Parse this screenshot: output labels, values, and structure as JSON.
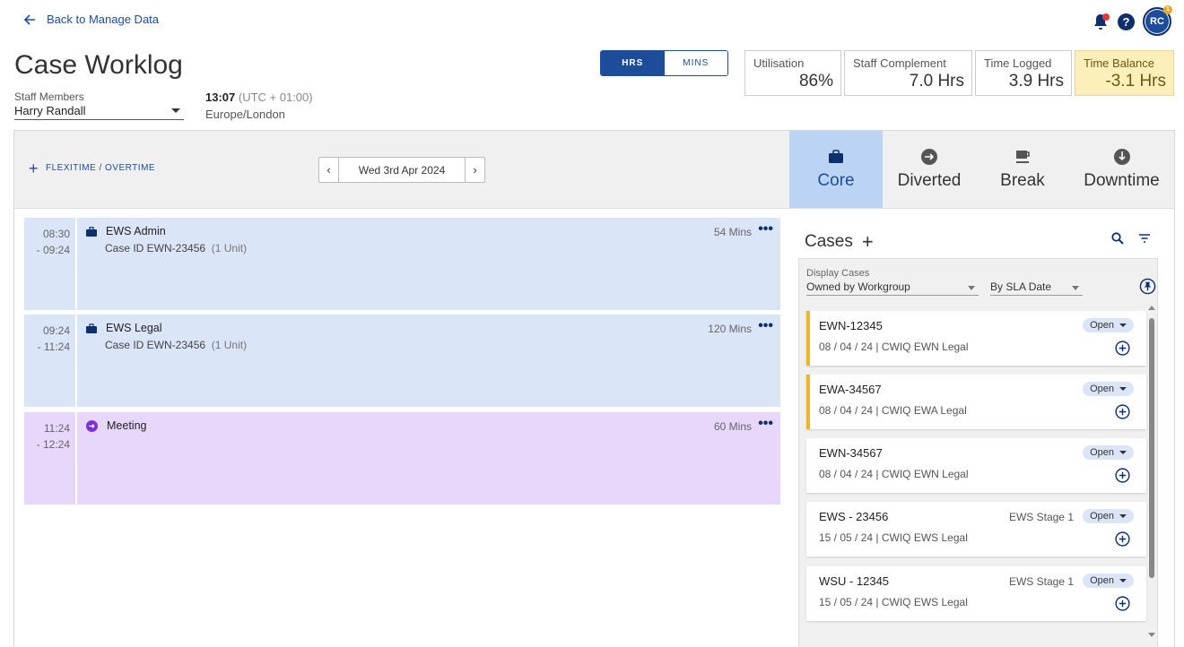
{
  "nav": {
    "back_label": "Back to Manage Data"
  },
  "user": {
    "initials": "RC",
    "notification_count": "1"
  },
  "page": {
    "title": "Case Worklog"
  },
  "staff": {
    "label": "Staff Members",
    "selected": "Harry Randall"
  },
  "clock": {
    "time": "13:07",
    "offset": "(UTC + 01:00)",
    "region": "Europe/London"
  },
  "unit_toggle": {
    "hrs": "HRS",
    "mins": "MINS",
    "selected": "HRS"
  },
  "stats": [
    {
      "label": "Utilisation",
      "value": "86%"
    },
    {
      "label": "Staff Complement",
      "value": "7.0 Hrs"
    },
    {
      "label": "Time Logged",
      "value": "3.9 Hrs"
    },
    {
      "label": "Time Balance",
      "value": "-3.1 Hrs"
    }
  ],
  "toolbar": {
    "flexi_label": "FLEXITIME / OVERTIME",
    "date": "Wed 3rd Apr 2024",
    "prev": "‹",
    "next": "›"
  },
  "modes": [
    {
      "label": "Core",
      "icon": "briefcase-icon"
    },
    {
      "label": "Diverted",
      "icon": "diverted-icon"
    },
    {
      "label": "Break",
      "icon": "coffee-icon"
    },
    {
      "label": "Downtime",
      "icon": "downtime-icon"
    }
  ],
  "entries": [
    {
      "start": "08:30",
      "end": "- 09:24",
      "name": "EWS Admin",
      "case": "Case ID EWN-23456",
      "units": "(1 Unit)",
      "duration": "54 Mins"
    },
    {
      "start": "09:24",
      "end": "- 11:24",
      "name": "EWS Legal",
      "case": "Case ID EWN-23456",
      "units": "(1 Unit)",
      "duration": "120 Mins"
    },
    {
      "start": "11:24",
      "end": "- 12:24",
      "name": "Meeting",
      "duration": "60 Mins"
    }
  ],
  "cases": {
    "title": "Cases",
    "add": "+",
    "display_label": "Display Cases",
    "display_value": "Owned by Workgroup",
    "sort_value": "By SLA Date",
    "items": [
      {
        "id": "EWN-12345",
        "meta": "08 / 04 / 24  |  CWIQ EWN Legal",
        "status": "Open",
        "stage": ""
      },
      {
        "id": "EWA-34567",
        "meta": "08 / 04 / 24  |  CWIQ EWA Legal",
        "status": "Open",
        "stage": ""
      },
      {
        "id": "EWN-34567",
        "meta": "08 / 04 / 24  |  CWIQ EWN Legal",
        "status": "Open",
        "stage": ""
      },
      {
        "id": "EWS - 23456",
        "meta": "15 / 05 / 24  |  CWIQ EWS Legal",
        "status": "Open",
        "stage": "EWS Stage 1"
      },
      {
        "id": "WSU - 12345",
        "meta": "15 / 05 / 24  |  CWIQ EWS Legal",
        "status": "Open",
        "stage": "EWS Stage 1"
      }
    ]
  },
  "colors": {
    "primary": "#1c4c9a",
    "core_entry": "#dbe5f8",
    "diverted_entry": "#e6d7fb",
    "warning": "#fcefb9",
    "flag": "#f4b41a"
  }
}
